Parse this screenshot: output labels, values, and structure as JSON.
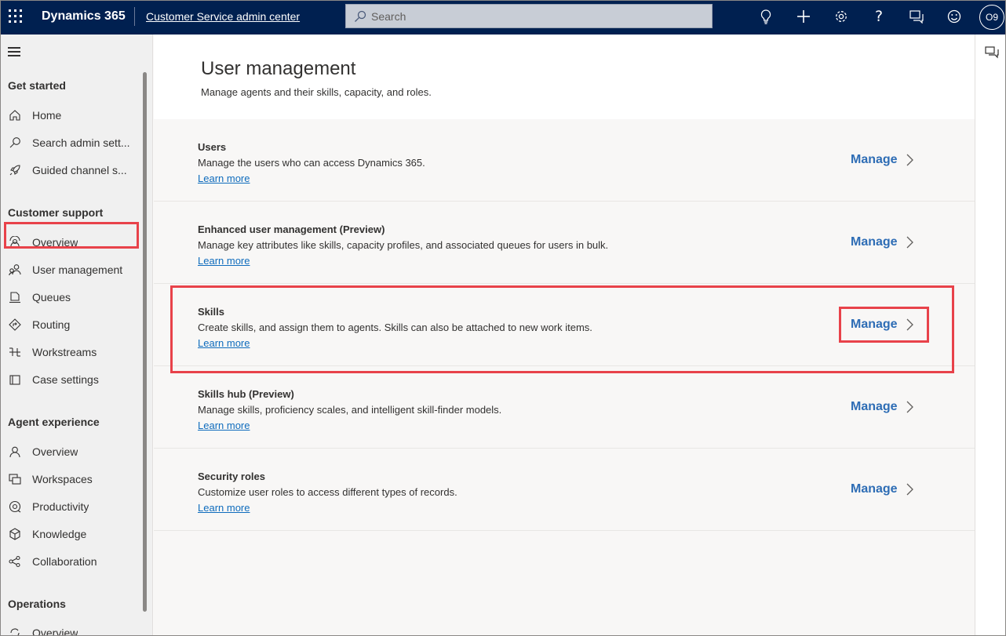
{
  "topbar": {
    "brand": "Dynamics 365",
    "app_name": "Customer Service admin center",
    "search_placeholder": "Search",
    "avatar_initials": "O9",
    "icons": [
      "lightbulb-icon",
      "plus-icon",
      "gear-icon",
      "help-icon",
      "feedback-icon",
      "smiley-icon"
    ]
  },
  "sidebar": {
    "sections": [
      {
        "title": "Get started",
        "items": [
          {
            "label": "Home",
            "icon": "home-icon"
          },
          {
            "label": "Search admin sett...",
            "icon": "search-icon"
          },
          {
            "label": "Guided channel s...",
            "icon": "rocket-icon"
          }
        ]
      },
      {
        "title": "Customer support",
        "items": [
          {
            "label": "Overview",
            "icon": "overview-icon"
          },
          {
            "label": "User management",
            "icon": "users-icon",
            "selected": true
          },
          {
            "label": "Queues",
            "icon": "queue-icon"
          },
          {
            "label": "Routing",
            "icon": "routing-icon"
          },
          {
            "label": "Workstreams",
            "icon": "workstreams-icon"
          },
          {
            "label": "Case settings",
            "icon": "case-icon"
          }
        ]
      },
      {
        "title": "Agent experience",
        "items": [
          {
            "label": "Overview",
            "icon": "person-icon"
          },
          {
            "label": "Workspaces",
            "icon": "workspaces-icon"
          },
          {
            "label": "Productivity",
            "icon": "productivity-icon"
          },
          {
            "label": "Knowledge",
            "icon": "knowledge-icon"
          },
          {
            "label": "Collaboration",
            "icon": "collaboration-icon"
          }
        ]
      },
      {
        "title": "Operations",
        "items": [
          {
            "label": "Overview",
            "icon": "operations-icon"
          }
        ]
      }
    ]
  },
  "main": {
    "title": "User management",
    "subtitle": "Manage agents and their skills, capacity, and roles.",
    "rows": [
      {
        "title": "Users",
        "description": "Manage the users who can access Dynamics 365.",
        "link": "Learn more",
        "action": "Manage"
      },
      {
        "title": "Enhanced user management (Preview)",
        "description": "Manage key attributes like skills, capacity profiles, and associated queues for users in bulk.",
        "link": "Learn more",
        "action": "Manage"
      },
      {
        "title": "Skills",
        "description": "Create skills, and assign them to agents. Skills can also be attached to new work items.",
        "link": "Learn more",
        "action": "Manage",
        "highlighted": true
      },
      {
        "title": "Skills hub (Preview)",
        "description": "Manage skills, proficiency scales, and intelligent skill-finder models.",
        "link": "Learn more",
        "action": "Manage"
      },
      {
        "title": "Security roles",
        "description": "Customize user roles to access different types of records.",
        "link": "Learn more",
        "action": "Manage"
      }
    ]
  },
  "colors": {
    "topbar": "#002050",
    "accent_link": "#0f6cbd",
    "manage": "#2e6db5",
    "highlight": "#e8424a"
  }
}
